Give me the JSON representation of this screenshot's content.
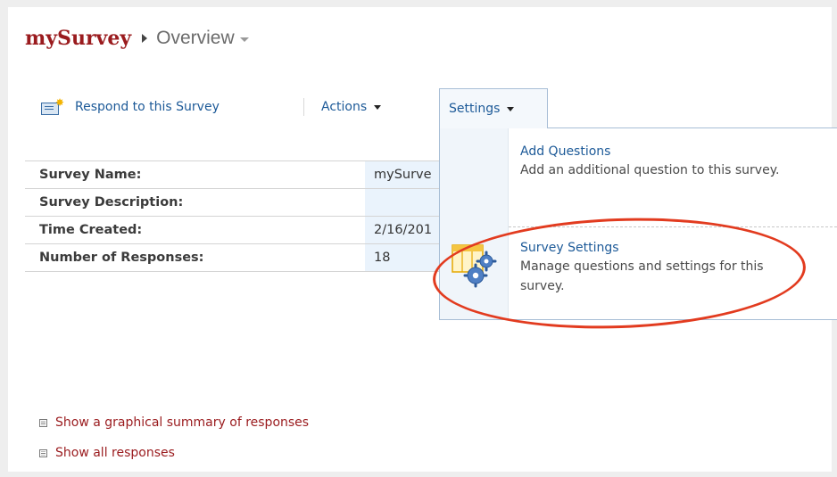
{
  "breadcrumb": {
    "site": "mySurvey",
    "page": "Overview"
  },
  "toolbar": {
    "respond_label": "Respond to this Survey",
    "actions_label": "Actions",
    "settings_label": "Settings"
  },
  "properties": [
    {
      "label": "Survey Name:",
      "value": "mySurve"
    },
    {
      "label": "Survey Description:",
      "value": ""
    },
    {
      "label": "Time Created:",
      "value": "2/16/201"
    },
    {
      "label": "Number of Responses:",
      "value": "18"
    }
  ],
  "settings_menu": {
    "items": [
      {
        "title": "Add Questions",
        "description": "Add an additional question to this survey."
      },
      {
        "title": "Survey Settings",
        "description": "Manage questions and settings for this survey."
      }
    ]
  },
  "links": [
    "Show a graphical summary of responses",
    "Show all responses"
  ],
  "colors": {
    "site_title": "#9a1b1e",
    "link_blue": "#1d5a98",
    "highlight": "#e23b1f"
  },
  "icons": [
    "respond-icon",
    "survey-settings-icon",
    "expand-icon"
  ]
}
